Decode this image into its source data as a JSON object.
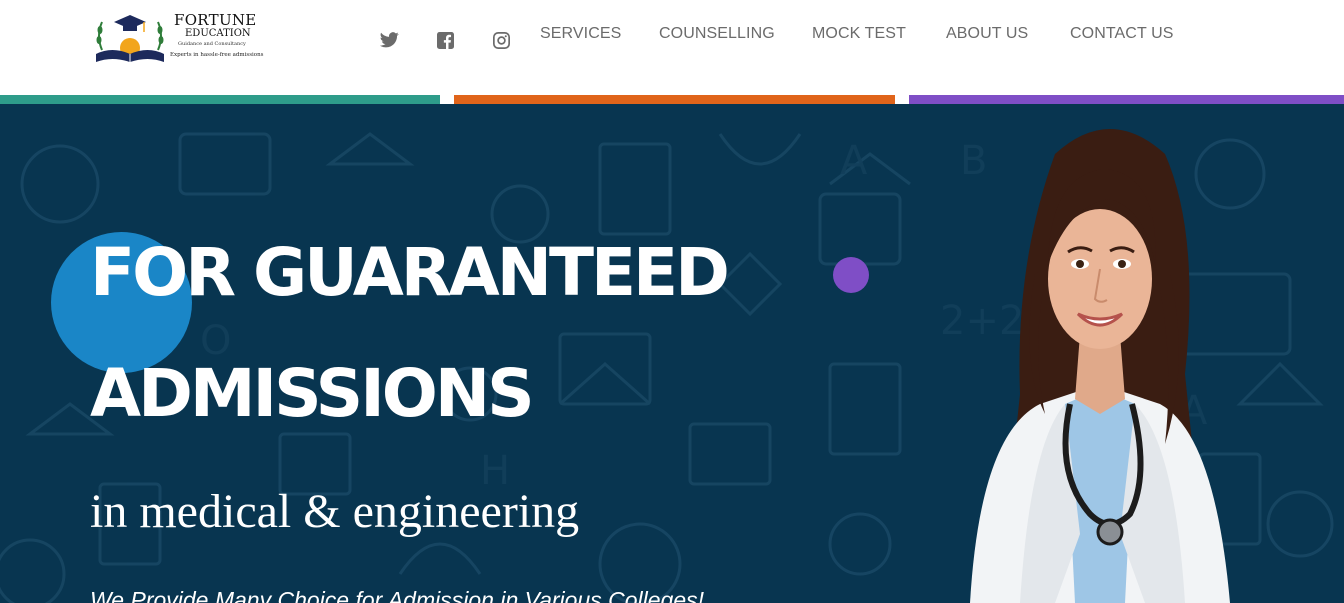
{
  "brand": {
    "name": "FORTUNE",
    "name_line2": "EDUCATION",
    "tagline": "Guidance and Consultancy",
    "slogan": "Experts in hassle-free admissions"
  },
  "social": [
    {
      "icon": "twitter-icon"
    },
    {
      "icon": "facebook-icon"
    },
    {
      "icon": "instagram-icon"
    }
  ],
  "nav": {
    "items": [
      "SERVICES",
      "COUNSELLING",
      "MOCK TEST",
      "ABOUT US",
      "CONTACT US"
    ]
  },
  "accent_bars": [
    "#2e9c8a",
    "#e0641a",
    "#7f4ec6"
  ],
  "hero": {
    "headline_line1": "FOR GUARANTEED",
    "headline_line2": "ADMISSIONS",
    "subheadline": "in medical & engineering",
    "description": "We Provide Many Choice for Admission in Various Colleges!",
    "background_color": "#083550"
  }
}
